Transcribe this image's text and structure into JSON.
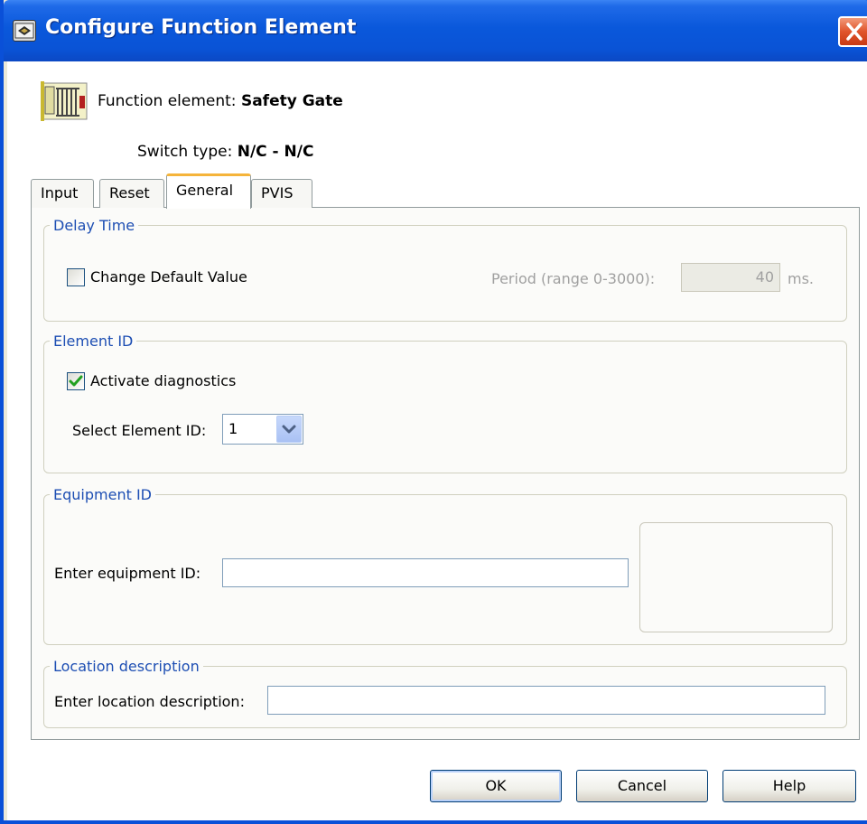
{
  "window": {
    "title": "Configure Function Element"
  },
  "header": {
    "function_element_label": "Function element:",
    "function_element_value": "Safety Gate",
    "switch_type_label": "Switch type:",
    "switch_type_value": "N/C - N/C"
  },
  "tabs": [
    {
      "label": "Input",
      "active": false
    },
    {
      "label": "Reset",
      "active": false
    },
    {
      "label": "General",
      "active": true
    },
    {
      "label": "PVIS",
      "active": false
    }
  ],
  "delay_time": {
    "legend": "Delay Time",
    "change_default_label": "Change Default Value",
    "change_default_checked": false,
    "period_label": "Period (range 0-3000):",
    "period_value": "40",
    "period_unit": "ms."
  },
  "element_id": {
    "legend": "Element ID",
    "activate_diagnostics_label": "Activate diagnostics",
    "activate_diagnostics_checked": true,
    "select_label": "Select Element ID:",
    "selected_value": "1"
  },
  "equipment_id": {
    "legend": "Equipment ID",
    "input_label": "Enter equipment ID:",
    "input_value": ""
  },
  "location": {
    "legend": "Location description",
    "input_label": "Enter location description:",
    "input_value": ""
  },
  "buttons": {
    "ok": "OK",
    "cancel": "Cancel",
    "help": "Help"
  },
  "colors": {
    "titlebar": "#0a58db",
    "legend_text": "#1d4eb3",
    "active_tab_accent": "#f5b43a",
    "close_button": "#e0542b"
  },
  "icons": {
    "title": "app-window-icon",
    "close": "close-icon",
    "function": "safety-gate-icon",
    "dropdown": "chevron-down-icon",
    "check": "checkmark-icon"
  }
}
